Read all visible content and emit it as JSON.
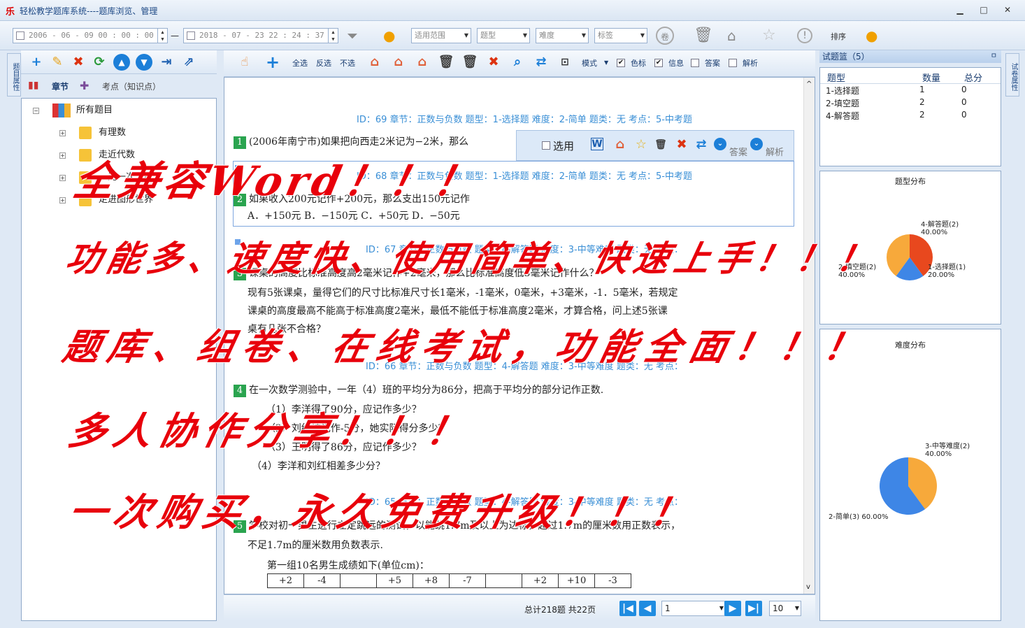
{
  "window": {
    "logo": "乐",
    "title": "轻松教学题库系统----题库浏览、管理",
    "minimize": "▁",
    "maximize": "□",
    "close": "✕"
  },
  "filter": {
    "date_from": "2006 - 06 - 09   00 : 00 : 00",
    "date_to": "2018 - 07 - 23   22 : 24 : 37",
    "range_label": "适用范围",
    "type_label": "题型",
    "difficulty_label": "难度",
    "tag_label": "标签",
    "sort_label": "排序",
    "dash": "—"
  },
  "left": {
    "strip_label": "题目属性",
    "tab_chapter": "章节",
    "tab_point": "考点（知识点）",
    "tree": [
      {
        "label": "所有题目"
      },
      {
        "label": "有理数"
      },
      {
        "label": "走近代数"
      },
      {
        "label": "一元一次方程"
      },
      {
        "label": "走进图形世界"
      }
    ]
  },
  "main_toolbar": {
    "all": "全选",
    "invert": "反选",
    "none": "不选",
    "mode": "模式",
    "color_label": "色标",
    "info": "信息",
    "answer": "答案",
    "analysis": "解析",
    "color_checked": true,
    "info_checked": true,
    "answer_checked": false,
    "analysis_checked": false
  },
  "hover_bar": {
    "select": "选用",
    "answer": "答案",
    "analysis": "解析"
  },
  "questions": [
    {
      "meta": "ID：69 章节：正数与负数  题型：1-选择题  难度：2-简单  题类：无  考点：5-中考题",
      "num": "1",
      "lines": [
        "(2006年南宁市)如果把向西走2米记为−2米，那么"
      ]
    },
    {
      "meta": "ID：68 章节：正数与负数  题型：1-选择题  难度：2-简单  题类：无  考点：5-中考题",
      "num": "2",
      "lines": [
        "如果收入200元记作+200元，那么支出150元记作",
        "A．+150元      B．−150元      C．+50元      D．−50元"
      ]
    },
    {
      "meta": "ID：67 章节：正数与负数  题型：4-解答题  难度：3-中等难度  题类：无  考点：",
      "num": "3",
      "lines": [
        "课桌的高度比标准高度高2毫米记作+2毫米，那么比标准高度低3毫米记作什么？",
        "现有5张课桌，量得它们的尺寸比标准尺寸长1毫米，-1毫米，0毫米，+3毫米，-1．5毫米，若规定",
        "课桌的高度最高不能高于标准高度2毫米，最低不能低于标准高度2毫米，才算合格，问上述5张课",
        "桌有几张不合格？"
      ]
    },
    {
      "meta": "ID：66 章节：正数与负数  题型：4-解答题  难度：3-中等难度  题类：无  考点：",
      "num": "4",
      "lines": [
        "在一次数学测验中，一年（4）班的平均分为86分，把高于平均分的部分记作正数.",
        "（1）李洋得了90分，应记作多少？",
        "（2）刘红被记作-5分，她实际得分多少？",
        "（3）王明得了86分，应记作多少？",
        "（4）李洋和刘红相差多少分？"
      ]
    },
    {
      "meta": "ID：65 章节：正数与负数  题型：4-解答题  难度：3-中等难度  题类：无  考点：",
      "num": "5",
      "lines": [
        "学校对初一男生进行立定跳远的测试，以能跳1.7m及以上为达标，超过1.7m的厘米数用正数表示，",
        "不足1.7m的厘米数用负数表示.",
        "第一组10名男生成绩如下(单位cm)："
      ]
    }
  ],
  "score_table": [
    "+2",
    "-4",
    "",
    "+5",
    "+8",
    "-7",
    "",
    "+2",
    "+10",
    "-3"
  ],
  "pager": {
    "summary": "总计218题  共22页",
    "page": "1",
    "page_size": "10"
  },
  "right": {
    "strip_label": "试卷属性",
    "basket_title": "试题篮（5）",
    "pin": "ㅁ",
    "columns": [
      "题型",
      "数量",
      "总分"
    ],
    "rows": [
      {
        "type": "1-选择题",
        "count": "1",
        "score": "0"
      },
      {
        "type": "2-填空题",
        "count": "2",
        "score": "0"
      },
      {
        "type": "4-解答题",
        "count": "2",
        "score": "0"
      }
    ]
  },
  "chart_data": [
    {
      "type": "pie",
      "title": "题型分布",
      "labels": [
        "4-解答题(2)",
        "1-选择题(1)",
        "2-填空题(2)"
      ],
      "pct_labels": [
        "40.00%",
        "20.00%",
        "40.00%"
      ],
      "values": [
        2,
        1,
        2
      ],
      "colors": [
        "#e8481e",
        "#3e86e6",
        "#f7a93b"
      ]
    },
    {
      "type": "pie",
      "title": "难度分布",
      "labels": [
        "3-中等难度(2)",
        "2-简单(3)"
      ],
      "pct_labels": [
        "40.00%",
        "60.00%"
      ],
      "values": [
        2,
        3
      ],
      "colors": [
        "#f7a93b",
        "#3e86e6"
      ]
    }
  ],
  "overlay": [
    "全兼容Word！！！",
    "功能多、速度快、使用简单、快速上手！！！",
    "题库、组卷、在线考试，功能全面！！！",
    "多人协作分享！！！",
    "一次购买，永久免费升级！！！"
  ]
}
